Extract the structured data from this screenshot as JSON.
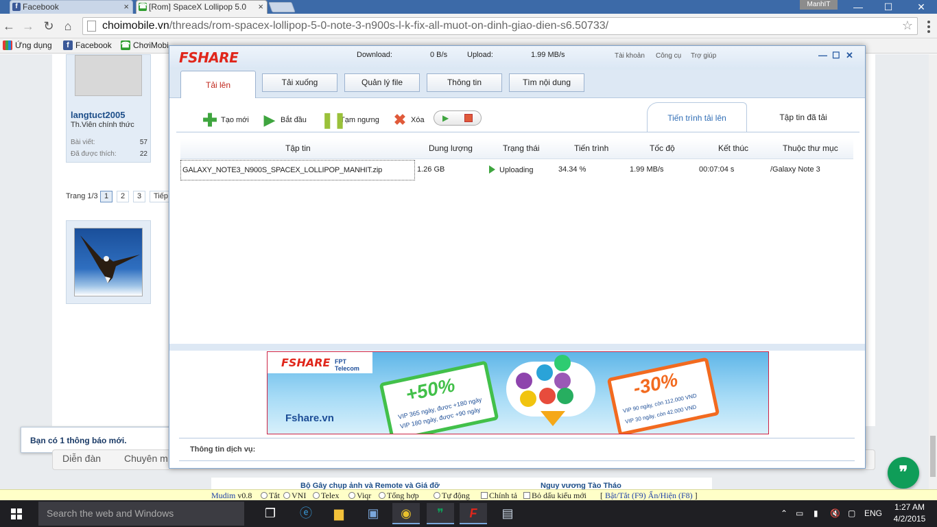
{
  "browser": {
    "tabs": [
      {
        "title": "Facebook",
        "icon": "facebook-icon",
        "color": "#3b5998"
      },
      {
        "title": "[Rom] SpaceX Lollipop 5.0",
        "icon": "phone-icon",
        "color": "#2e9d2e"
      }
    ],
    "window_user": "ManhIT",
    "window_controls": {
      "minimize": "—",
      "maximize": "☐",
      "close": "✕"
    },
    "url_host": "choimobile.vn",
    "url_path": "/threads/rom-spacex-lollipop-5-0-note-3-n900s-l-k-fix-all-muot-on-dinh-giao-dien-s6.50733/",
    "bookmarks": [
      {
        "label": "Ứng dụng",
        "icon": "apps-grid-icon"
      },
      {
        "label": "Facebook",
        "icon": "facebook-icon"
      },
      {
        "label": "ChơiMobi",
        "icon": "phone-icon"
      }
    ]
  },
  "forum": {
    "username": "langtuct2005",
    "rank": "Th.Viên chính thức",
    "stats": [
      {
        "label": "Bài viết:",
        "value": "57"
      },
      {
        "label": "Đã được thích:",
        "value": "22"
      }
    ],
    "pager": {
      "label": "Trang 1/3",
      "pages": [
        "1",
        "2",
        "3"
      ],
      "next": "Tiếp"
    },
    "notification": "Bạn có 1 thông báo mới.",
    "nav": [
      "Diễn đàn",
      "Chuyên m"
    ],
    "news": [
      "Bộ Gây chụp ảnh và Remote và Giá đỡ",
      "Nguy vương Tào Tháo"
    ],
    "chat_icon": "hangouts-quote-icon"
  },
  "fshare": {
    "logo": "FSHARE",
    "download_label": "Download:",
    "download_value": "0 B/s",
    "upload_label": "Upload:",
    "upload_value": "1.99 MB/s",
    "menu": [
      "Tài khoản",
      "Công cụ",
      "Trợ giúp"
    ],
    "window_buttons": {
      "minimize": "—",
      "maximize": "☐",
      "close": "✕"
    },
    "tabs": [
      "Tải lên",
      "Tải xuống",
      "Quản lý file",
      "Thông tin",
      "Tìm nội dung"
    ],
    "toolbar": {
      "new": "Tạo mới",
      "start": "Bắt đầu",
      "pause": "Tạm ngưng",
      "delete": "Xóa"
    },
    "subtabs": [
      "Tiến trình tải lên",
      "Tập tin đã tải"
    ],
    "columns": [
      "Tập tin",
      "Dung lượng",
      "Trạng thái",
      "Tiến trình",
      "Tốc độ",
      "Kết thúc",
      "Thuộc thư mục"
    ],
    "rows": [
      {
        "file": "GALAXY_NOTE3_N900S_SPACEX_LOLLIPOP_MANHIT.zip",
        "size": "1.26 GB",
        "status": "Uploading",
        "progress": "34.34 %",
        "speed": "1.99 MB/s",
        "eta": "00:07:04 s",
        "folder": "/Galaxy Note 3"
      }
    ],
    "banner": {
      "logo": "FSHARE",
      "partner": "FPT Telecom",
      "site": "Fshare.vn",
      "left_discount": "+50%",
      "left_line1": "VIP 365 ngày, được +180 ngày",
      "left_line2": "VIP 180 ngày, được +90 ngày",
      "right_discount": "-30%",
      "right_line1": "VIP 90 ngày, còn 112.000 VND",
      "right_line2": "VIP 30 ngày, còn 42.000 VND"
    },
    "service_info_label": "Thông tin dịch vụ:"
  },
  "mudim": {
    "brand": "Mudim",
    "version": "v0.8",
    "options": [
      "Tắt",
      "VNI",
      "Telex",
      "Viqr",
      "Tổng hợp",
      "Tự động"
    ],
    "checks": [
      "Chính tả",
      "Bỏ dấu kiểu mới"
    ],
    "link1": "Bật/Tắt (F9)",
    "link2": "Ẩn/Hiện (F8)"
  },
  "taskbar": {
    "search_placeholder": "Search the web and Windows",
    "language": "ENG",
    "time": "1:27 AM",
    "date": "4/2/2015"
  },
  "colors": {
    "accent": "#2f6db5",
    "fshare_red": "#e0261b",
    "status_green": "#3fa53f"
  }
}
